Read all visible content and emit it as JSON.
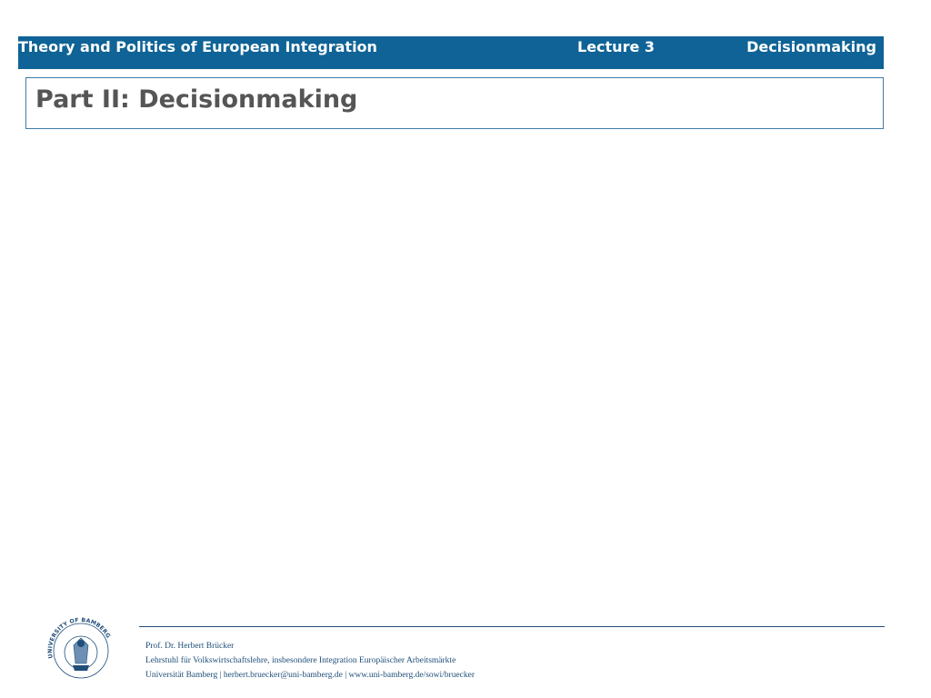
{
  "header": {
    "course": "Theory and Politics of European Integration",
    "lecture": "Lecture 3",
    "topic": "Decisionmaking"
  },
  "slide": {
    "title": "Part II: Decisionmaking"
  },
  "footer": {
    "seal_text": "OTTO-FRIEDRICH-UNIVERSITÄT BAMBERG",
    "seal_outer_text": "UNIVERSITY OF BAMBERG",
    "name": "Prof. Dr. Herbert Brücker",
    "chair": "Lehrstuhl für Volkswirtschaftslehre, insbesondere Integration Europäischer Arbeitsmärkte",
    "contact": "Universität Bamberg | herbert.bruecker@uni-bamberg.de | www.uni-bamberg.de/sowi/bruecker"
  },
  "colors": {
    "header_bg": "#0f6396",
    "title_text": "#555555",
    "footer_text": "#1f4e79"
  }
}
